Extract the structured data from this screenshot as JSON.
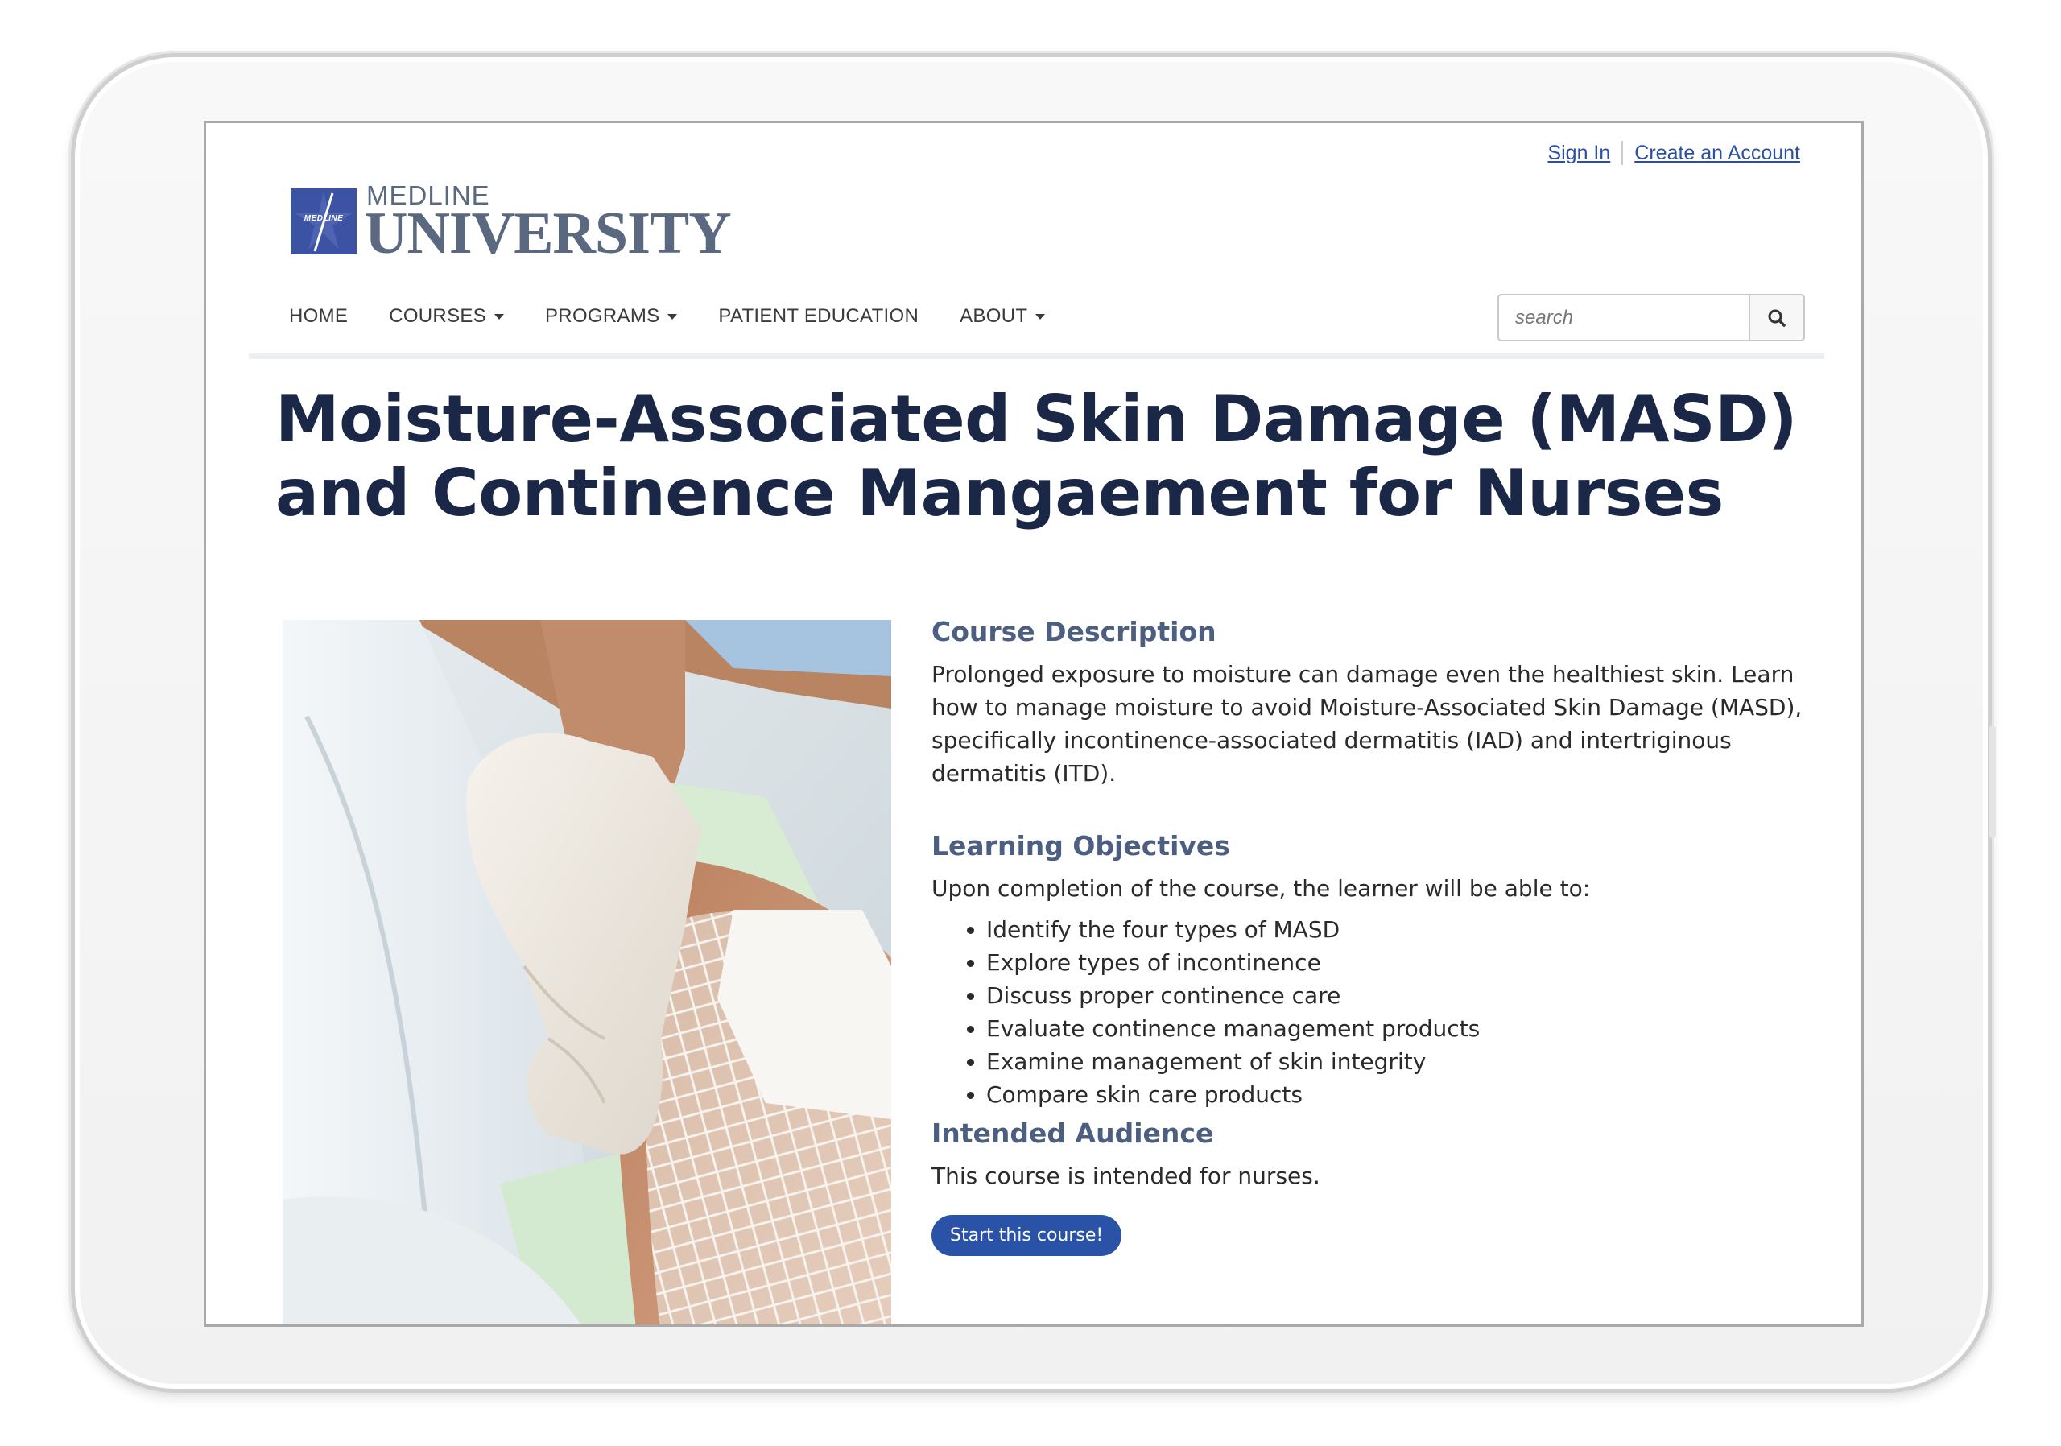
{
  "header": {
    "sign_in": "Sign In",
    "create_account": "Create an Account",
    "logo_top": "MEDLINE",
    "logo_bottom": "UNIVERSITY",
    "logo_mark_text": "MEDLINE"
  },
  "nav": {
    "items": [
      {
        "label": "HOME",
        "dropdown": false
      },
      {
        "label": "COURSES",
        "dropdown": true
      },
      {
        "label": "PROGRAMS",
        "dropdown": true
      },
      {
        "label": "PATIENT EDUCATION",
        "dropdown": false
      },
      {
        "label": "ABOUT",
        "dropdown": true
      }
    ]
  },
  "search": {
    "placeholder": "search",
    "button_icon": "search-icon"
  },
  "page": {
    "title": "Moisture-Associated Skin Damage (MASD) and Continence Mangaement for Nurses"
  },
  "course": {
    "description_heading": "Course Description",
    "description": "Prolonged exposure to moisture can damage even the healthiest skin. Learn how to manage moisture to avoid Moisture-Associated Skin Damage (MASD), specifically incontinence-associated dermatitis (IAD) and intertriginous dermatitis (ITD).",
    "objectives_heading": "Learning Objectives",
    "objectives_intro": "Upon completion of the course, the learner will be able to:",
    "objectives": [
      "Identify the four types of MASD",
      "Explore types of incontinence",
      "Discuss proper continence care",
      "Evaluate continence management products",
      "Examine management of skin integrity",
      "Compare skin care products"
    ],
    "audience_heading": "Intended Audience",
    "audience": "This course is intended for nurses.",
    "start_button": "Start this course!"
  },
  "colors": {
    "brand_blue": "#3c53a3",
    "button_blue": "#2a52a6",
    "title_navy": "#1a2747",
    "heading_slate": "#4d5f80"
  }
}
